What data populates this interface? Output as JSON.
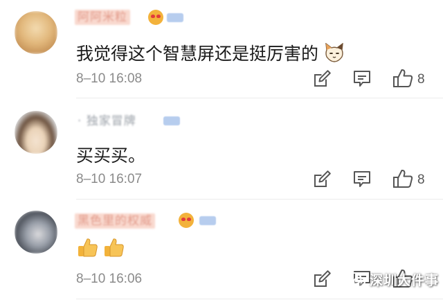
{
  "comments": [
    {
      "username": "阿阿米粒",
      "text": "我觉得这个智慧屏还是挺厉害的",
      "time": "8–10 16:08",
      "likes": "8"
    },
    {
      "username": "· 独家冒牌",
      "text": "买买买。",
      "time": "8–10 16:07",
      "likes": "8"
    },
    {
      "username": "黑色里的权威",
      "text": "",
      "time": "8–10 16:06",
      "likes": ""
    }
  ],
  "watermark": {
    "text": "深圳大件事"
  },
  "colors": {
    "name_tint": "#f6c7ba",
    "vip_badge": "#b7cdee",
    "time": "#8a8a8a",
    "icon": "#555555"
  },
  "icons": [
    "edit-icon",
    "reply-comment-icon",
    "thumbs-up-icon",
    "cat-emoji-icon",
    "thumbs-up-emoji",
    "wechat-logo-icon"
  ]
}
